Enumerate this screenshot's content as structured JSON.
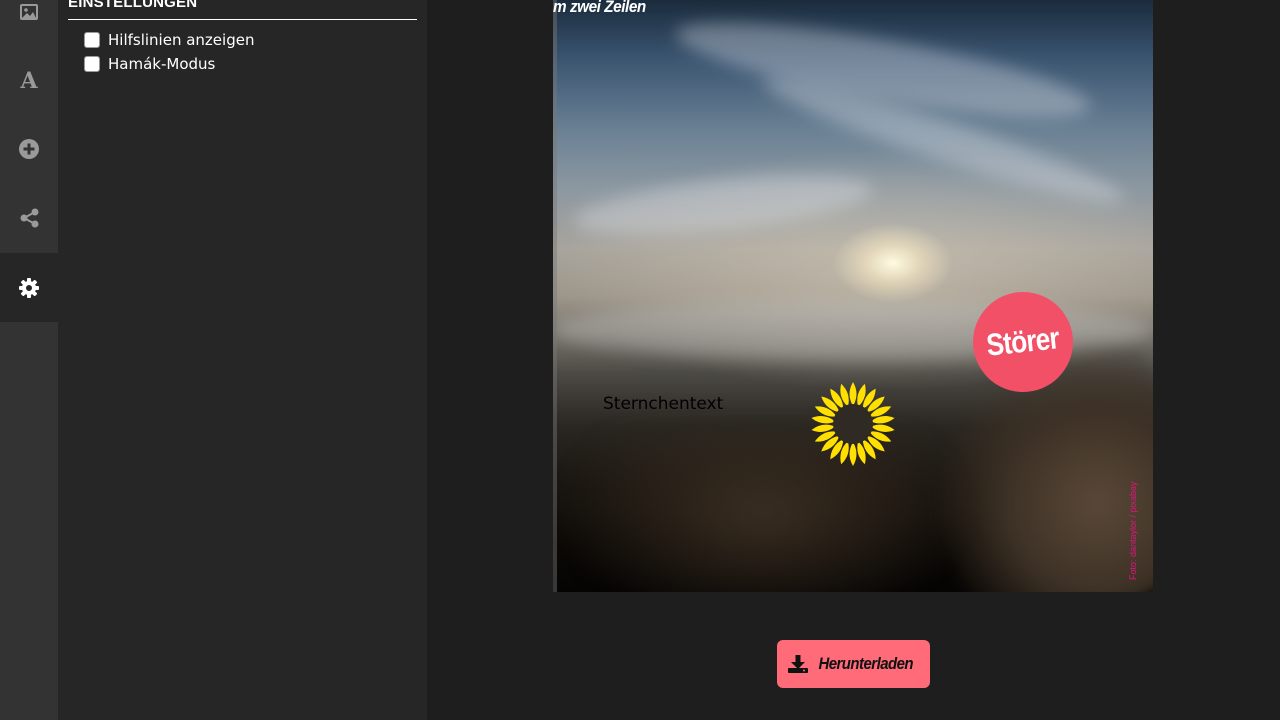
{
  "rail": {
    "items": [
      {
        "icon": "image-icon",
        "active": false
      },
      {
        "icon": "text-icon",
        "label": "A",
        "active": false
      },
      {
        "icon": "plus-circle-icon",
        "active": false
      },
      {
        "icon": "share-icon",
        "active": false
      },
      {
        "icon": "gear-icon",
        "active": true
      }
    ]
  },
  "settings": {
    "title": "EINSTELLUNGEN",
    "options": [
      {
        "label": "Hilfslinien anzeigen",
        "checked": false
      },
      {
        "label": "Hamák-Modus",
        "checked": false
      }
    ]
  },
  "canvas": {
    "headline": "m zwei Zeilen",
    "stoerer": "Störer",
    "sternchentext": "Sternchentext",
    "credit": "Foto: dantaylor / pixabay"
  },
  "download": {
    "label": "Herunterladen"
  },
  "colors": {
    "accent": "#ff6b79",
    "stoerer": "#f25066",
    "sunflower": "#ffe000",
    "credit": "#e0157d"
  }
}
